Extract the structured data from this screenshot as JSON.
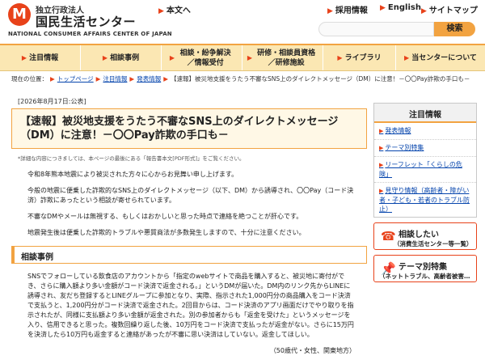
{
  "header": {
    "logo_mark": "M",
    "logo_sub": "独立行政法人",
    "logo_main": "国民生活センター",
    "logo_en": "NATIONAL CONSUMER AFFAIRS CENTER OF JAPAN",
    "links": [
      {
        "label": "本文へ",
        "icon": "arrow-right-icon"
      },
      {
        "label": "採用情報",
        "icon": "arrow-right-icon"
      },
      {
        "label": "English",
        "icon": "arrow-right-icon"
      },
      {
        "label": "サイトマップ",
        "icon": "arrow-right-icon"
      }
    ],
    "search_button": "検索",
    "search_placeholder": ""
  },
  "nav": {
    "items": [
      {
        "label": "注目情報"
      },
      {
        "label": "相談事例"
      },
      {
        "label": "相談・紛争解決／情報受付"
      },
      {
        "label": "研修・相談員資格／研修施設"
      },
      {
        "label": "ライブラリ"
      },
      {
        "label": "当センターについて"
      }
    ]
  },
  "breadcrumb": {
    "prefix": "現在の位置：",
    "items": [
      "トップページ",
      "注目情報",
      "発表情報"
    ],
    "current": "【速報】被災地支援をうたう不審なSNS上のダイレクトメッセージ（DM）に注意！－〇〇Pay詐欺の手口も－"
  },
  "article": {
    "date": "[2026年8月17日:公表]",
    "title": "【速報】被災地支援をうたう不審なSNS上のダイレクトメッセージ（DM）に注意！－〇〇Pay詐欺の手口も－",
    "note": "*詳細な内容につきましては、本ページの最後にある「報告書本文[PDF形式]」をご覧ください。",
    "para1": "令和8年熊本地震により被災された方々に心からお見舞い申し上げます。",
    "para2": "今般の地震に便乗した詐欺的なSNS上のダイレクトメッセージ（以下、DM）から誘導され、〇〇Pay（コード決済）詐欺にあったという相談が寄せられています。",
    "para3": "不審なDMやメールは無視する、もしくはおかしいと思った時点で連絡を絶つことが肝心です。",
    "para4": "地震発生後は便乗した詐欺的トラブルや悪質商法が多数発生しますので、十分に注意ください。",
    "section_title": "相談事例",
    "case_text": "SNSでフォローしている飲食店のアカウントから「指定のwebサイトで商品を購入すると、被災地に寄付ができ、さらに購入額より多い金額がコード決済で返金される。」というDMが届いた。DM内のリンク先からLINEに誘導され、友だち登録するとLINEグループに参加となり、実際、指示された1,000円分の商品購入をコード決済で支払うと、1,200円分がコード決済で返金された。2回目からは、コード決済のアプリ画面だけでやり取りを指示されたが、同様に支払額より多い金額が返金された。別の参加者からも「返金を受けた」というメッセージを入り、信用できると思った。複数回繰り返した後、10万円をコード決済で支払ったが返金がない。さらに15万円を決済したら10万円も返金すると連絡があったが不審に思い決済はしていない。返金してほしい。",
    "signature": "（50歳代・女性、関東地方）"
  },
  "sidebar": {
    "heading": "注目情報",
    "links": [
      {
        "label": "発表情報"
      },
      {
        "label": "テーマ別特集"
      },
      {
        "label": "リーフレット「くらしの危険」"
      },
      {
        "label": "見守り情報（高齢者・障がい者・子ども・若者のトラブル防止）"
      }
    ],
    "buttons": [
      {
        "line1": "相談したい",
        "line2": "（消費生活センター等一覧）",
        "icon": "phone-icon"
      },
      {
        "line1": "テーマ別特集",
        "line2": "（ネットトラブル、高齢者被害…",
        "icon": "pin-icon"
      }
    ]
  },
  "colors": {
    "accent": "#f2a341",
    "brand": "#e8421a",
    "nav_bg": "#fbe7b3",
    "link": "#0645ad"
  }
}
